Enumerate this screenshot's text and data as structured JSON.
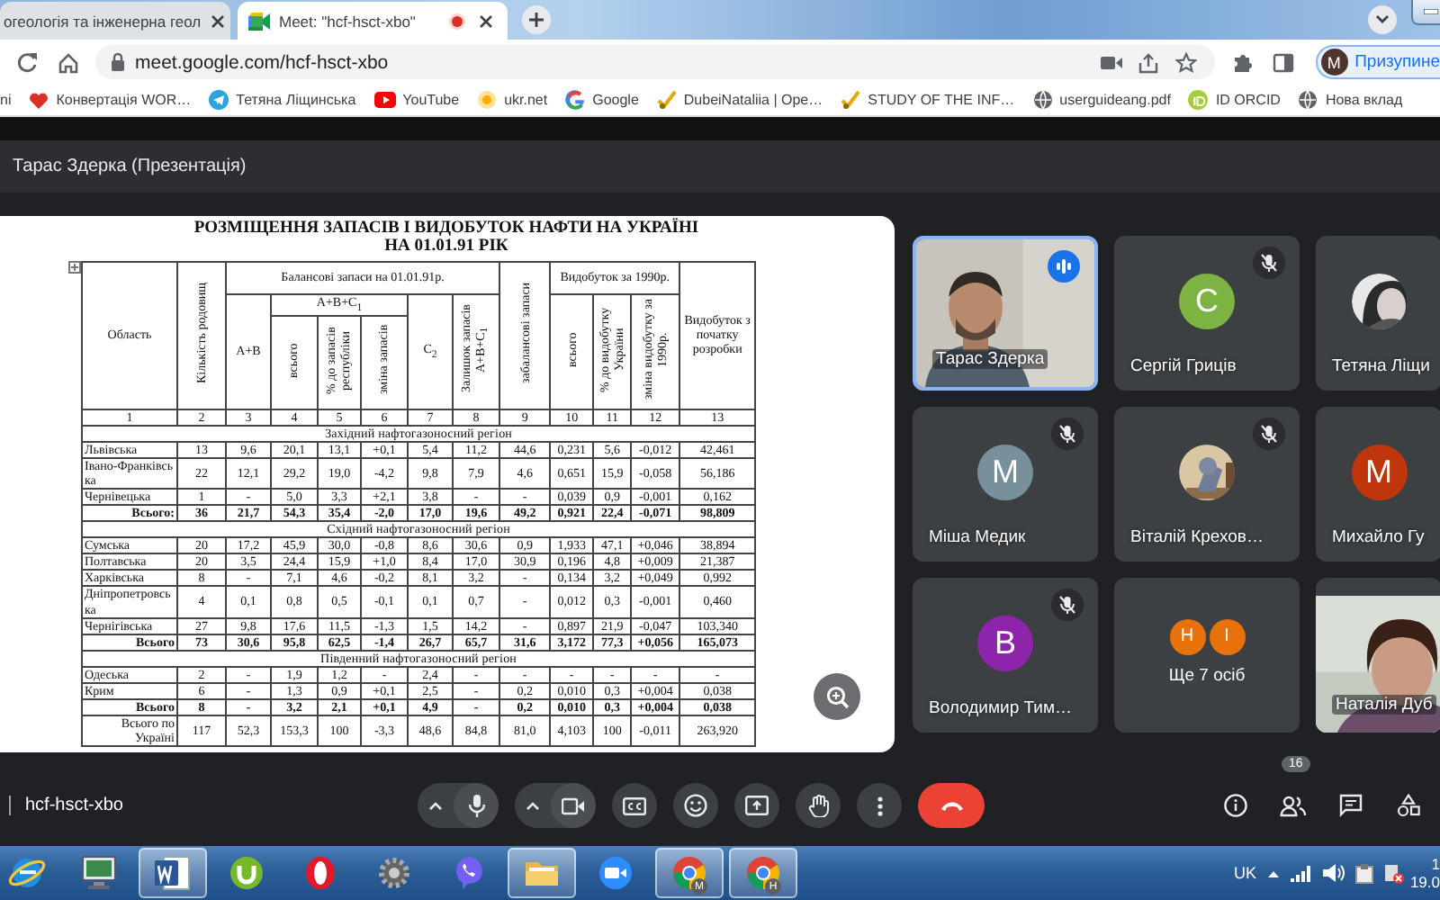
{
  "browser": {
    "tabs": [
      {
        "title": "огеологія та інженерна геол",
        "kind": "doc",
        "selected": false,
        "recording": false
      },
      {
        "title": "Meet: \"hcf-hsct-xbo\"",
        "kind": "meet",
        "selected": true,
        "recording": true
      }
    ],
    "address": "meet.google.com/hcf-hsct-xbo",
    "profile": {
      "initial": "M",
      "label": "Призупине"
    },
    "bookmarks": [
      {
        "label": "ni",
        "kind": "none"
      },
      {
        "label": "Конвертація WOR…",
        "kind": "heart"
      },
      {
        "label": "Тетяна Ліщинська",
        "kind": "telegram"
      },
      {
        "label": "YouTube",
        "kind": "youtube"
      },
      {
        "label": "ukr.net",
        "kind": "sun"
      },
      {
        "label": "Google",
        "kind": "google"
      },
      {
        "label": "DubeiNataliia | Ope…",
        "kind": "pencil"
      },
      {
        "label": "STUDY OF THE INF…",
        "kind": "pencil"
      },
      {
        "label": "userguideang.pdf",
        "kind": "globe"
      },
      {
        "label": "ID ORCID",
        "kind": "orcid"
      },
      {
        "label": "Нова вклад",
        "kind": "globe"
      }
    ]
  },
  "meet": {
    "presenter_title": "Тарас Здерка (Презентація)",
    "slide": {
      "title": "РОЗМІЩЕННЯ ЗАПАСІВ І ВИДОБУТОК НАФТИ НА УКРАЇНІ\nНА 01.01.91 РІК",
      "header_rows": [
        [
          {
            "text": "Область",
            "rowspan": 3,
            "vertical": false
          },
          {
            "text": "Кількість родовищ",
            "rowspan": 3,
            "vertical": true
          },
          {
            "text": "Балансові запаси на 01.01.91р.",
            "colspan": 6,
            "vertical": false
          },
          {
            "text": "забалансові запаси",
            "rowspan": 3,
            "vertical": true
          },
          {
            "text": "Видобуток за 1990р.",
            "colspan": 3,
            "vertical": false
          },
          {
            "text": "Видобуток з початку розробки",
            "rowspan": 3,
            "vertical": false
          }
        ],
        [
          {
            "text": "A+B",
            "rowspan": 2,
            "vertical": false
          },
          {
            "text": "A+B+C$_{1}$",
            "colspan": 3,
            "vertical": false
          },
          {
            "text": "C$_{2}$",
            "rowspan": 2,
            "vertical": false
          },
          {
            "text": "Залишок запасів A+B+C$_{1}$",
            "rowspan": 2,
            "vertical": true
          },
          {
            "text": "всього",
            "rowspan": 2,
            "vertical": true
          },
          {
            "text": "% до видобутку України",
            "rowspan": 2,
            "vertical": true
          },
          {
            "text": "зміна видобутку за 1990р.",
            "rowspan": 2,
            "vertical": true
          }
        ],
        [
          {
            "text": "всього",
            "vertical": true
          },
          {
            "text": "% до запасів республіки",
            "vertical": true
          },
          {
            "text": "зміна запасів",
            "vertical": true
          }
        ]
      ],
      "rows": [
        {
          "kind": "numbers",
          "cells": [
            "1",
            "2",
            "3",
            "4",
            "5",
            "6",
            "7",
            "8",
            "9",
            "10",
            "11",
            "12",
            "13"
          ]
        },
        {
          "kind": "region",
          "text": "Західний нафтогазоносний регіон"
        },
        {
          "kind": "data",
          "cells": [
            "Львівська",
            "13",
            "9,6",
            "20,1",
            "13,1",
            "+0,1",
            "5,4",
            "11,2",
            "44,6",
            "0,231",
            "5,6",
            "-0,012",
            "42,461"
          ]
        },
        {
          "kind": "data",
          "cells": [
            "Івано-Франківська",
            "22",
            "12,1",
            "29,2",
            "19,0",
            "-4,2",
            "9,8",
            "7,9",
            "4,6",
            "0,651",
            "15,9",
            "-0,058",
            "56,186"
          ]
        },
        {
          "kind": "data",
          "cells": [
            "Чернівецька",
            "1",
            "-",
            "5,0",
            "3,3",
            "+2,1",
            "3,8",
            "-",
            "-",
            "0,039",
            "0,9",
            "-0,001",
            "0,162"
          ]
        },
        {
          "kind": "total",
          "cells": [
            "Всього:",
            "36",
            "21,7",
            "54,3",
            "35,4",
            "-2,0",
            "17,0",
            "19,6",
            "49,2",
            "0,921",
            "22,4",
            "-0,071",
            "98,809"
          ]
        },
        {
          "kind": "region",
          "text": "Східний нафтогазоносний регіон"
        },
        {
          "kind": "data",
          "cells": [
            "Сумська",
            "20",
            "17,2",
            "45,9",
            "30,0",
            "-0,8",
            "8,6",
            "30,6",
            "0,9",
            "1,933",
            "47,1",
            "+0,046",
            "38,894"
          ]
        },
        {
          "kind": "data",
          "cells": [
            "Полтавська",
            "20",
            "3,5",
            "24,4",
            "15,9",
            "+1,0",
            "8,4",
            "17,0",
            "30,9",
            "0,196",
            "4,8",
            "+0,009",
            "21,387"
          ]
        },
        {
          "kind": "data",
          "cells": [
            "Харківська",
            "8",
            "-",
            "7,1",
            "4,6",
            "-0,2",
            "8,1",
            "3,2",
            "-",
            "0,134",
            "3,2",
            "+0,049",
            "0,992"
          ]
        },
        {
          "kind": "data",
          "cells": [
            "Дніпропетровська",
            "4",
            "0,1",
            "0,8",
            "0,5",
            "-0,1",
            "0,1",
            "0,7",
            "-",
            "0,012",
            "0,3",
            "-0,001",
            "0,460"
          ]
        },
        {
          "kind": "data",
          "cells": [
            "Чернігівська",
            "27",
            "9,8",
            "17,6",
            "11,5",
            "-1,3",
            "1,5",
            "14,2",
            "-",
            "0,897",
            "21,9",
            "-0,047",
            "103,340"
          ]
        },
        {
          "kind": "total",
          "cells": [
            "Всього",
            "73",
            "30,6",
            "95,8",
            "62,5",
            "-1,4",
            "26,7",
            "65,7",
            "31,6",
            "3,172",
            "77,3",
            "+0,056",
            "165,073"
          ]
        },
        {
          "kind": "region",
          "text": "Південний нафтогазоносний регіон"
        },
        {
          "kind": "data",
          "cells": [
            "Одеська",
            "2",
            "-",
            "1,9",
            "1,2",
            "-",
            "2,4",
            "-",
            "-",
            "-",
            "-",
            "-",
            "-"
          ]
        },
        {
          "kind": "data",
          "cells": [
            "Крим",
            "6",
            "-",
            "1,3",
            "0,9",
            "+0,1",
            "2,5",
            "-",
            "0,2",
            "0,010",
            "0,3",
            "+0,004",
            "0,038"
          ]
        },
        {
          "kind": "total",
          "cells": [
            "Всього",
            "8",
            "-",
            "3,2",
            "2,1",
            "+0,1",
            "4,9",
            "-",
            "0,2",
            "0,010",
            "0,3",
            "+0,004",
            "0,038"
          ]
        },
        {
          "kind": "summary",
          "cells": [
            "Всього по Україні",
            "117",
            "52,3",
            "153,3",
            "100",
            "-3,3",
            "48,6",
            "84,8",
            "81,0",
            "4,103",
            "100",
            "-0,011",
            "263,920"
          ]
        }
      ]
    },
    "participants": [
      {
        "name": "Тарас Здерка",
        "kind": "video",
        "muted": false,
        "speaking": true
      },
      {
        "name": "Сергій Гриців",
        "kind": "avatar",
        "initial": "С",
        "color": "#7cb342",
        "muted": true,
        "speaking": false
      },
      {
        "name": "Тетяна Ліщи",
        "muted": false,
        "speaking": false
      },
      {
        "name": "Міша Медик",
        "kind": "avatar",
        "initial": "М",
        "color": "#78909c",
        "muted": true,
        "speaking": false
      },
      {
        "name": "Віталій Крехов…",
        "muted": true,
        "speaking": false
      },
      {
        "name": "Михайло Гу",
        "kind": "avatar",
        "initial": "М",
        "color": "#bf360c",
        "muted": false,
        "speaking": false
      },
      {
        "name": "Володимир Тим…",
        "kind": "avatar",
        "initial": "В",
        "color": "#8e24aa",
        "muted": true,
        "speaking": false
      },
      {
        "name": "Ще 7 осіб",
        "kind": "more",
        "initials": [
          "Н",
          "І"
        ],
        "muted": false,
        "speaking": false
      },
      {
        "name": "Наталія Дуб",
        "kind": "video",
        "muted": false,
        "speaking": false
      }
    ],
    "meeting_code": "hcf-hsct-xbo",
    "people_count": "16"
  },
  "taskbar": {
    "apps": [
      {
        "kind": "computer",
        "active": false
      },
      {
        "kind": "word",
        "active": true
      },
      {
        "kind": "utorrent",
        "active": false
      },
      {
        "kind": "opera",
        "active": false
      },
      {
        "kind": "gear",
        "active": false
      },
      {
        "kind": "viber",
        "active": false
      },
      {
        "kind": "folder",
        "active": true
      },
      {
        "kind": "zoom",
        "active": false
      },
      {
        "kind": "chrome",
        "active": true,
        "badge": "M"
      },
      {
        "kind": "chrome",
        "active": true,
        "badge": "Н"
      }
    ],
    "language": "UK",
    "time": "1",
    "date": "19.0"
  }
}
